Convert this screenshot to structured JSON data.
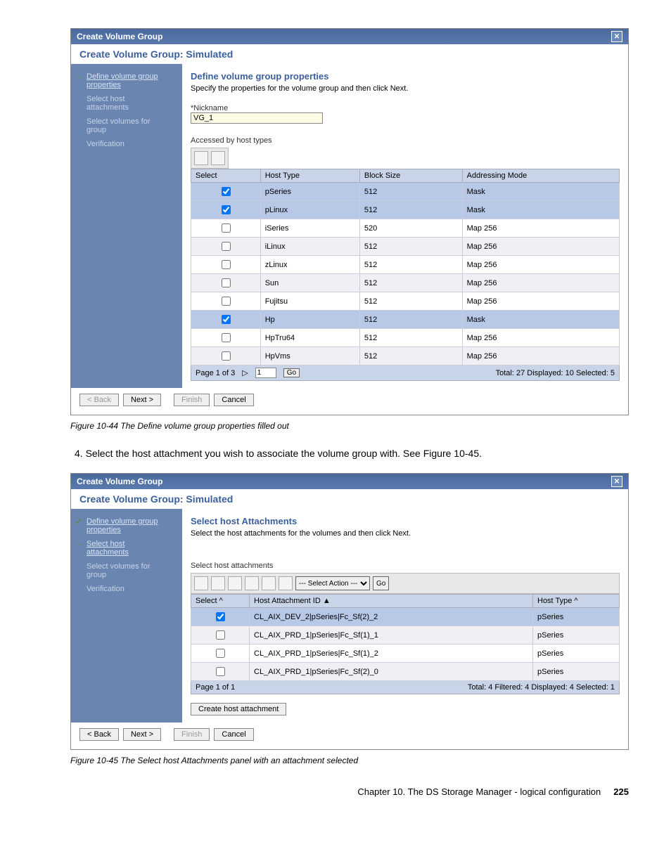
{
  "figure1": {
    "dialog_title": "Create Volume Group",
    "panel_title": "Create Volume Group: Simulated",
    "nav": {
      "item1": "Define volume group properties",
      "item2": "Select host attachments",
      "item3": "Select volumes for group",
      "item4": "Verification"
    },
    "content": {
      "heading": "Define volume group properties",
      "desc": "Specify the properties for the volume group and then click Next.",
      "nickname_label": "*Nickname",
      "nickname_value": "VG_1",
      "table_label": "Accessed by host types",
      "columns": {
        "c1": "Select",
        "c2": "Host Type",
        "c3": "Block Size",
        "c4": "Addressing Mode"
      },
      "rows": [
        {
          "sel": true,
          "host": "pSeries",
          "block": "512",
          "mode": "Mask"
        },
        {
          "sel": true,
          "host": "pLinux",
          "block": "512",
          "mode": "Mask"
        },
        {
          "sel": false,
          "host": "iSeries",
          "block": "520",
          "mode": "Map 256"
        },
        {
          "sel": false,
          "host": "iLinux",
          "block": "512",
          "mode": "Map 256"
        },
        {
          "sel": false,
          "host": "zLinux",
          "block": "512",
          "mode": "Map 256"
        },
        {
          "sel": false,
          "host": "Sun",
          "block": "512",
          "mode": "Map 256"
        },
        {
          "sel": false,
          "host": "Fujitsu",
          "block": "512",
          "mode": "Map 256"
        },
        {
          "sel": true,
          "host": "Hp",
          "block": "512",
          "mode": "Mask"
        },
        {
          "sel": false,
          "host": "HpTru64",
          "block": "512",
          "mode": "Map 256"
        },
        {
          "sel": false,
          "host": "HpVms",
          "block": "512",
          "mode": "Map 256"
        }
      ],
      "pager_page": "Page 1 of 3",
      "pager_input": "1",
      "pager_go": "Go",
      "pager_stats": "Total: 27   Displayed: 10   Selected: 5"
    },
    "buttons": {
      "back": "< Back",
      "next": "Next >",
      "finish": "Finish",
      "cancel": "Cancel"
    },
    "caption": "Figure 10-44   The Define volume group properties filled out"
  },
  "step_text": "4.  Select the host attachment you wish to associate the volume group with. See Figure 10-45.",
  "figure2": {
    "dialog_title": "Create Volume Group",
    "panel_title": "Create Volume Group: Simulated",
    "nav": {
      "item1": "Define volume group properties",
      "item2": "Select host attachments",
      "item3": "Select volumes for group",
      "item4": "Verification"
    },
    "content": {
      "heading": "Select host Attachments",
      "desc": "Select the host attachments for the volumes and then click Next.",
      "table_label": "Select host attachments",
      "action_placeholder": "--- Select Action ---",
      "go": "Go",
      "columns": {
        "c1": "Select ^",
        "c2": "Host Attachment ID  ▲",
        "c3": "Host Type  ^"
      },
      "rows": [
        {
          "sel": true,
          "id": "CL_AIX_DEV_2|pSeries|Fc_Sf(2)_2",
          "type": "pSeries"
        },
        {
          "sel": false,
          "id": "CL_AIX_PRD_1|pSeries|Fc_Sf(1)_1",
          "type": "pSeries"
        },
        {
          "sel": false,
          "id": "CL_AIX_PRD_1|pSeries|Fc_Sf(1)_2",
          "type": "pSeries"
        },
        {
          "sel": false,
          "id": "CL_AIX_PRD_1|pSeries|Fc_Sf(2)_0",
          "type": "pSeries"
        }
      ],
      "pager_page": "Page 1 of 1",
      "pager_stats": "Total: 4   Filtered: 4   Displayed: 4   Selected: 1",
      "create_btn": "Create host attachment"
    },
    "buttons": {
      "back": "< Back",
      "next": "Next >",
      "finish": "Finish",
      "cancel": "Cancel"
    },
    "caption": "Figure 10-45   The Select host Attachments panel with an attachment selected"
  },
  "footer": {
    "chapter": "Chapter 10. The DS Storage Manager - logical configuration",
    "page": "225"
  }
}
